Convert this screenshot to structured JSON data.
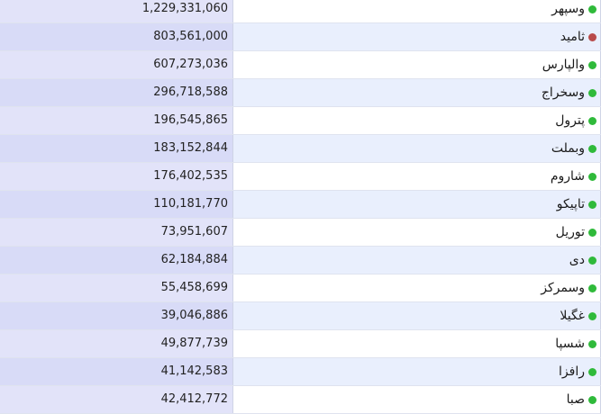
{
  "colors": {
    "status_green": "#2fba3a",
    "status_red": "#b84a4a"
  },
  "rows": [
    {
      "name": "وسپهر",
      "value": "1,229,331,060",
      "status": "green"
    },
    {
      "name": "ثامید",
      "value": "803,561,000",
      "status": "red"
    },
    {
      "name": "والپارس",
      "value": "607,273,036",
      "status": "green"
    },
    {
      "name": "وسخراج",
      "value": "296,718,588",
      "status": "green"
    },
    {
      "name": "پترول",
      "value": "196,545,865",
      "status": "green"
    },
    {
      "name": "وبملت",
      "value": "183,152,844",
      "status": "green"
    },
    {
      "name": "شاروم",
      "value": "176,402,535",
      "status": "green"
    },
    {
      "name": "تاپیکو",
      "value": "110,181,770",
      "status": "green"
    },
    {
      "name": "توریل",
      "value": "73,951,607",
      "status": "green"
    },
    {
      "name": "دی",
      "value": "62,184,884",
      "status": "green"
    },
    {
      "name": "وسمرکز",
      "value": "55,458,699",
      "status": "green"
    },
    {
      "name": "غگیلا",
      "value": "39,046,886",
      "status": "green"
    },
    {
      "name": "شسپا",
      "value": "49,877,739",
      "status": "green"
    },
    {
      "name": "رافزا",
      "value": "41,142,583",
      "status": "green"
    },
    {
      "name": "صبا",
      "value": "42,412,772",
      "status": "green"
    }
  ]
}
